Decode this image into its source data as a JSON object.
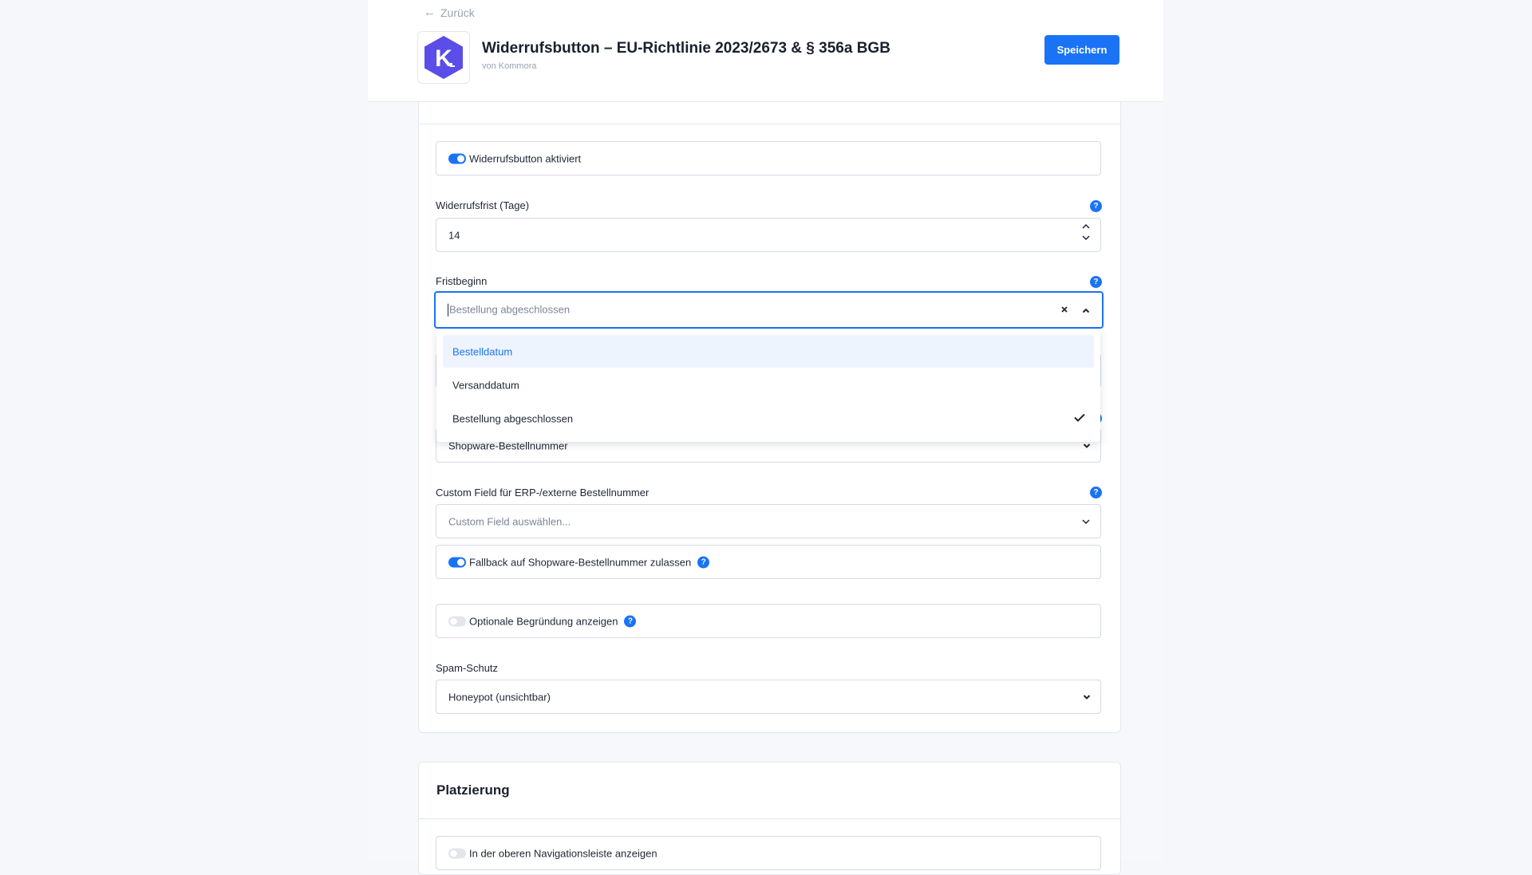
{
  "header": {
    "back_label": "Zurück",
    "title": "Widerrufsbutton – EU-Richtlinie 2023/2673 & § 356a BGB",
    "vendor": "von Kommora",
    "save_label": "Speichern",
    "logo_letter": "K",
    "logo_color": "#5b4de8"
  },
  "settings": {
    "enabled_toggle": {
      "label": "Widerrufsbutton aktiviert",
      "on": true
    },
    "withdrawal_period": {
      "label": "Widerrufsfrist (Tage)",
      "value": "14"
    },
    "period_start": {
      "label": "Fristbeginn",
      "placeholder": "Bestellung abgeschlossen",
      "options": [
        {
          "label": "Bestelldatum",
          "highlighted": true,
          "selected": false
        },
        {
          "label": "Versanddatum",
          "highlighted": false,
          "selected": false
        },
        {
          "label": "Bestellung abgeschlossen",
          "highlighted": false,
          "selected": true
        }
      ]
    },
    "order_number_source": {
      "value": "Shopware-Bestellnummer"
    },
    "custom_field": {
      "label": "Custom Field für ERP-/externe Bestellnummer",
      "placeholder": "Custom Field auswählen..."
    },
    "fallback_toggle": {
      "label": "Fallback auf Shopware-Bestellnummer zulassen",
      "on": true
    },
    "optional_reason_toggle": {
      "label": "Optionale Begründung anzeigen",
      "on": false
    },
    "spam_protection": {
      "label": "Spam-Schutz",
      "value": "Honeypot (unsichtbar)"
    }
  },
  "placement": {
    "heading": "Platzierung",
    "top_nav_toggle": {
      "label": "In der oberen Navigationsleiste anzeigen",
      "on": false
    }
  },
  "colors": {
    "accent": "#1a73f5",
    "border": "#d5dae3",
    "background": "#f6f7fb"
  },
  "help_glyph": "?"
}
